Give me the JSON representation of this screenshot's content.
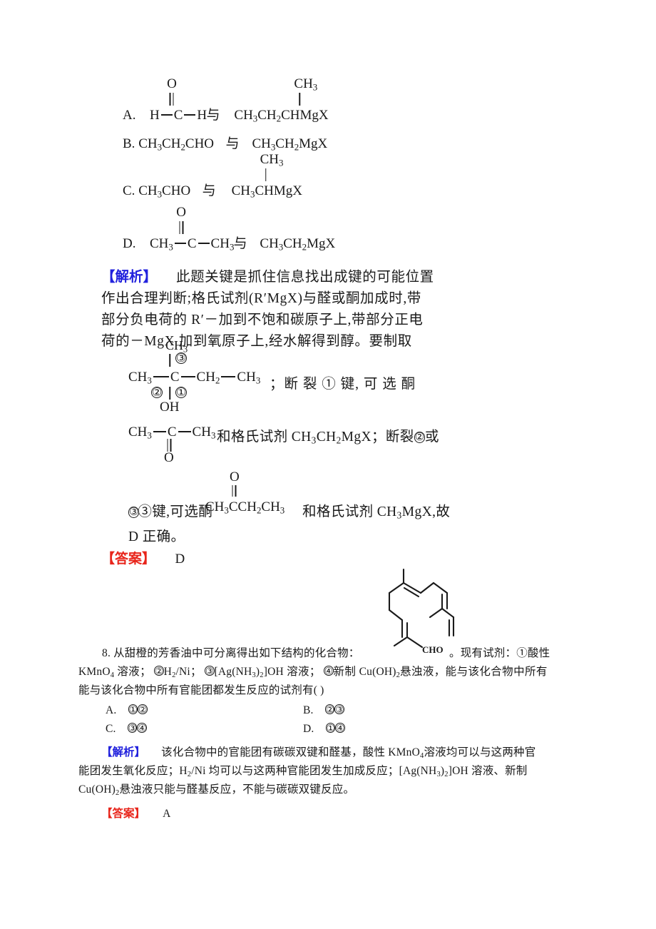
{
  "document": {
    "type": "chemistry-workbook-page",
    "language": "zh-CN"
  },
  "question7": {
    "options": [
      {
        "letter": "A.",
        "left_structure": {
          "top_atom": "O",
          "chain": [
            "H",
            "C",
            "H"
          ],
          "bond_type": "double-up"
        },
        "conjunction": "与",
        "right_structure": {
          "branch": "CH3",
          "chain": "CH3CH2CHMgX"
        }
      },
      {
        "letter": "B.",
        "left_text": "CH3CH2CHO",
        "conjunction": "与",
        "right_text": "CH3CH2MgX"
      },
      {
        "letter": "C.",
        "left_text": "CH3CHO",
        "conjunction": "与",
        "right_structure": {
          "branch": "CH3",
          "chain": "CH3CHMgX"
        }
      },
      {
        "letter": "D.",
        "left_structure": {
          "top_atom": "O",
          "chain": [
            "CH3",
            "C",
            "CH3"
          ],
          "bond_type": "double-up"
        },
        "conjunction": "与",
        "right_text": "CH3CH2MgX"
      }
    ],
    "explanation": {
      "label": "【解析】",
      "lines": [
        "此题关键是抓住信息找出成键的可能位置",
        "作出合理判断;格氏试剂(R′MgX)与醛或酮加成时,带",
        "部分负电荷的 R′－加到不饱和碳原子上,带部分正电",
        "荷的－MgX 加到氧原子上,经水解得到醇。要制取"
      ],
      "structure1": {
        "top_label": "CH3",
        "bond_marks": {
          "top": "③",
          "left": "②",
          "bottom": "①"
        },
        "chain_left": "CH3",
        "center": "C",
        "chain_right": [
          "CH2",
          "CH3"
        ],
        "bottom_group": "OH"
      },
      "after_structure1": "；断 裂 ① 键, 可 选 酮",
      "structure2": {
        "chain": [
          "CH3",
          "C",
          "CH3"
        ],
        "bottom_atom": "O",
        "bond_type": "double-down"
      },
      "after_structure2": "和格氏试剂 CH3CH2MgX；断裂②或",
      "structure3": {
        "top_atom": "O",
        "chain_text": "CH3CCH2CH3",
        "bond_type": "double-up"
      },
      "line_before_structure3": "③键,可选酮",
      "after_structure3": "和格氏试剂 CH3MgX,故",
      "final_line": "D 正确。"
    },
    "answer": {
      "label": "【答案】",
      "value": "D"
    }
  },
  "question8": {
    "number": "8.",
    "stem_part1": "从甜橙的芳香油中可分离得出如下结构的化合物：",
    "molecule_label": "CHO",
    "stem_part2": "。现有试剂：",
    "reagents": [
      {
        "index": "①",
        "text": "酸性 KMnO4 溶液；"
      },
      {
        "index": "②",
        "text": "H2/Ni；"
      },
      {
        "index": "③",
        "text": "[Ag(NH3)2]OH 溶液；"
      },
      {
        "index": "④",
        "text": "新制 Cu(OH)2 悬浊液，"
      }
    ],
    "stem_part3": "能与该化合物中所有官能团都发生反应的试剂有(        )",
    "options": [
      {
        "letter": "A.",
        "value": "①②"
      },
      {
        "letter": "B.",
        "value": "②③"
      },
      {
        "letter": "C.",
        "value": "③④"
      },
      {
        "letter": "D.",
        "value": "①④"
      }
    ],
    "explanation": {
      "label": "【解析】",
      "lines": [
        "该化合物中的官能团有碳碳双键和醛基，酸性 KMnO4 溶液均可以与这两种官",
        "能团发生氧化反应；H2/Ni 均可以与这两种官能团发生加成反应；[Ag(NH3)2]OH 溶液、新制",
        "Cu(OH)2悬浊液只能与醛基反应，不能与碳碳双键反应。"
      ]
    },
    "answer": {
      "label": "【答案】",
      "value": "A"
    }
  },
  "colors": {
    "explanation_label": "#2222dd",
    "answer_label": "#e8251b",
    "text": "#1a1a1a",
    "background": "#ffffff"
  }
}
